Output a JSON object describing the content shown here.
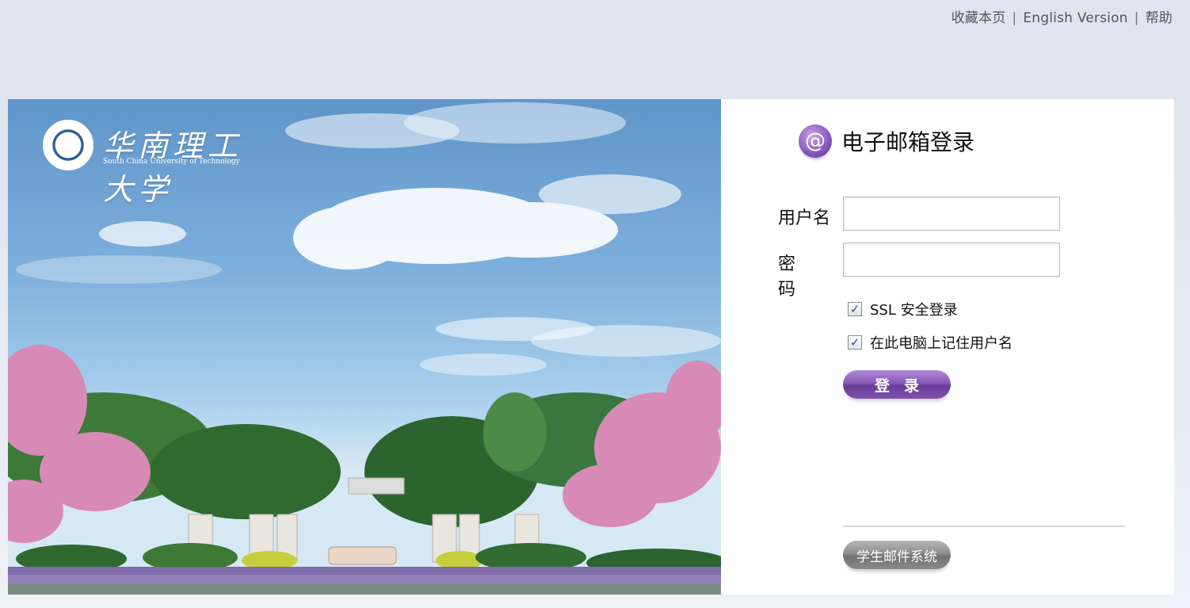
{
  "top_links": {
    "bookmark": "收藏本页",
    "english": "English Version",
    "help": "帮助",
    "separator": "|"
  },
  "branding": {
    "name_cn": "华南理工大学",
    "name_en": "South China University of Technology"
  },
  "login": {
    "title": "电子邮箱登录",
    "username_label": "用户名",
    "username_value": "",
    "password_label": "密码",
    "password_value": "",
    "ssl_label": "SSL 安全登录",
    "ssl_checked": true,
    "remember_label": "在此电脑上记住用户名",
    "remember_checked": true,
    "submit_label": "登录",
    "student_label": "学生邮件系统"
  },
  "icons": {
    "at": "@",
    "check": "✓"
  },
  "colors": {
    "accent_purple": "#8757b8",
    "page_bg": "#dfe4ee",
    "secondary_gray": "#8e8e8e"
  }
}
